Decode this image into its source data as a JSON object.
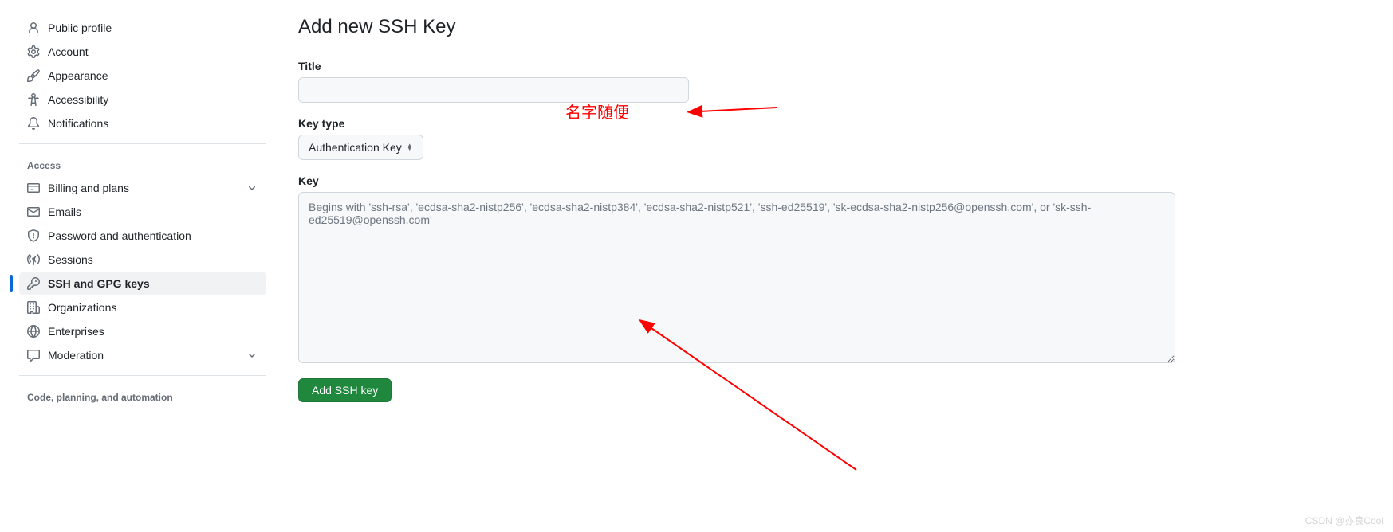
{
  "sidebar": {
    "items": [
      {
        "icon": "person-icon",
        "label": "Public profile"
      },
      {
        "icon": "gear-icon",
        "label": "Account"
      },
      {
        "icon": "paintbrush-icon",
        "label": "Appearance"
      },
      {
        "icon": "accessibility-icon",
        "label": "Accessibility"
      },
      {
        "icon": "bell-icon",
        "label": "Notifications"
      }
    ],
    "access_title": "Access",
    "access_items": [
      {
        "icon": "card-icon",
        "label": "Billing and plans",
        "chevron": true
      },
      {
        "icon": "mail-icon",
        "label": "Emails"
      },
      {
        "icon": "shield-icon",
        "label": "Password and authentication"
      },
      {
        "icon": "broadcast-icon",
        "label": "Sessions"
      },
      {
        "icon": "key-icon",
        "label": "SSH and GPG keys",
        "active": true
      },
      {
        "icon": "org-icon",
        "label": "Organizations"
      },
      {
        "icon": "globe-icon",
        "label": "Enterprises"
      },
      {
        "icon": "comment-icon",
        "label": "Moderation",
        "chevron": true
      }
    ],
    "code_title": "Code, planning, and automation"
  },
  "main": {
    "heading": "Add new SSH Key",
    "title_label": "Title",
    "title_value": "",
    "key_type_label": "Key type",
    "key_type_value": "Authentication Key",
    "key_label": "Key",
    "key_placeholder": "Begins with 'ssh-rsa', 'ecdsa-sha2-nistp256', 'ecdsa-sha2-nistp384', 'ecdsa-sha2-nistp521', 'ssh-ed25519', 'sk-ecdsa-sha2-nistp256@openssh.com', or 'sk-ssh-ed25519@openssh.com'",
    "submit_label": "Add SSH key"
  },
  "annotations": {
    "title_note": "名字随便"
  },
  "watermark": "CSDN @亦良Cool"
}
